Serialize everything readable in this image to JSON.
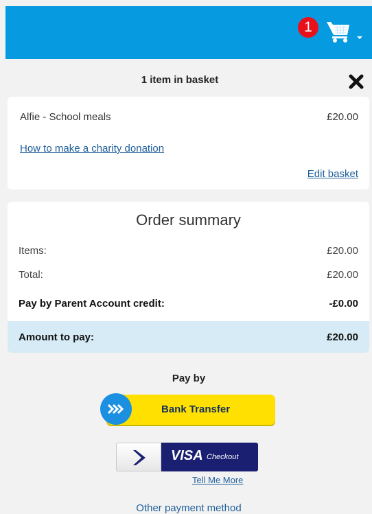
{
  "header": {
    "cart_count": "1",
    "accent_color": "#069ae0",
    "badge_color": "#e8111b",
    "cart_icon": "shopping-cart-icon",
    "dropdown_icon": "caret-down-icon"
  },
  "basket": {
    "title": "1 item in basket",
    "close_icon": "close-icon",
    "items": [
      {
        "name": "Alfie - School meals",
        "price": "£20.00"
      }
    ],
    "charity_link": "How to make a charity donation",
    "edit_link": "Edit basket"
  },
  "summary": {
    "title": "Order summary",
    "items_label": "Items:",
    "items_value": "£20.00",
    "total_label": "Total:",
    "total_value": "£20.00",
    "credit_label": "Pay by Parent Account credit:",
    "credit_value": "-£0.00",
    "amount_label": "Amount to pay:",
    "amount_value": "£20.00"
  },
  "payment": {
    "heading": "Pay by",
    "bank_transfer": "Bank Transfer",
    "bank_icon": "chevrons-right-icon",
    "visa_word": "VISA",
    "visa_checkout": "Checkout",
    "visa_icon": "chevron-right-icon",
    "tell_more": "Tell Me More",
    "other_method": "Other payment method"
  }
}
